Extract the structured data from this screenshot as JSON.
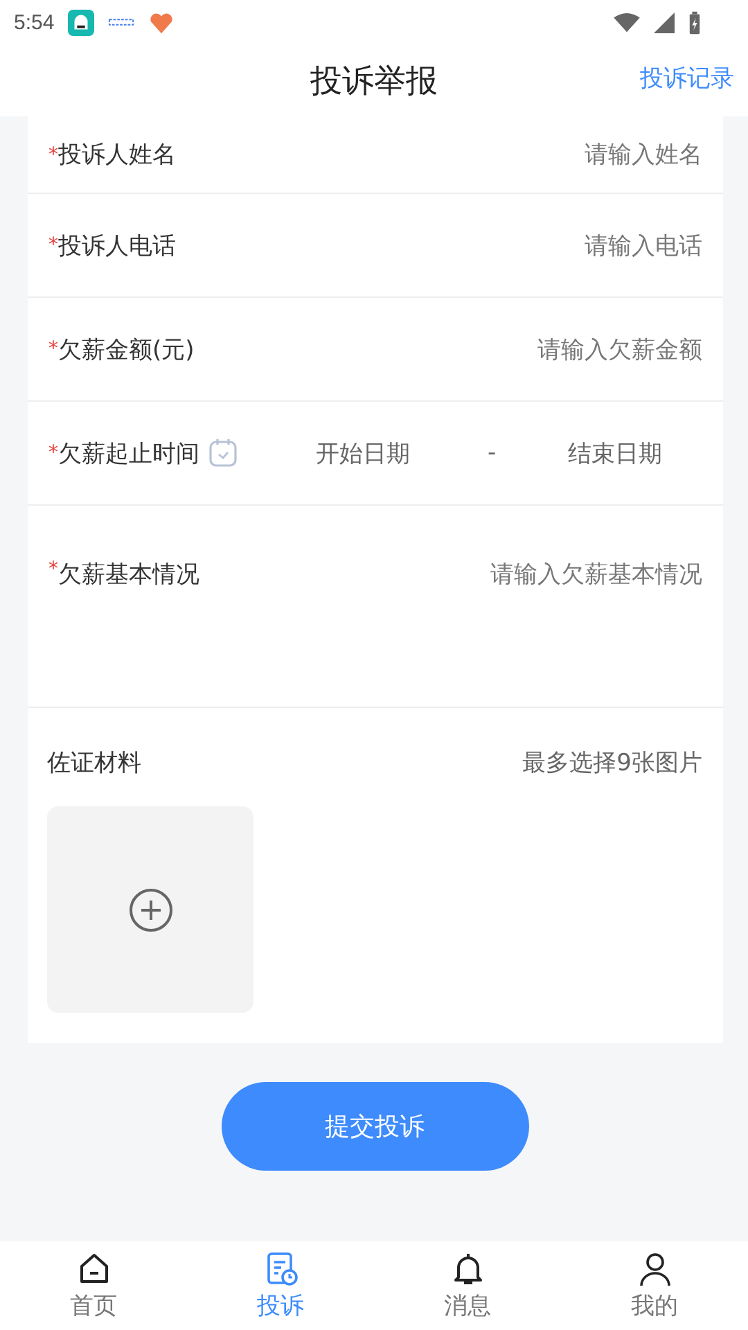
{
  "status_bar": {
    "time": "5:54"
  },
  "header": {
    "title": "投诉举报",
    "link": "投诉记录"
  },
  "fields": [
    {
      "kind": "text",
      "required_mark": "*",
      "label": "投诉人姓名",
      "placeholder": "请输入姓名"
    },
    {
      "kind": "text",
      "required_mark": "*",
      "label": "投诉人电话",
      "placeholder": "请输入电话"
    },
    {
      "kind": "text",
      "required_mark": "*",
      "label": "欠薪金额(元)",
      "placeholder": "请输入欠薪金额"
    },
    {
      "kind": "date",
      "required_mark": "*",
      "label": "欠薪起止时间",
      "start_placeholder": "开始日期",
      "separator": "-",
      "end_placeholder": "结束日期"
    },
    {
      "kind": "textarea",
      "required_mark": "*",
      "label": "欠薪基本情况",
      "placeholder": "请输入欠薪基本情况"
    }
  ],
  "upload": {
    "label": "佐证材料",
    "hint": "最多选择9张图片"
  },
  "submit": "提交投诉",
  "tabs": [
    {
      "kind": "home",
      "label": "首页",
      "selected": false
    },
    {
      "kind": "complaint",
      "label": "投诉",
      "selected": true
    },
    {
      "kind": "bell",
      "label": "消息",
      "selected": false
    },
    {
      "kind": "person",
      "label": "我的",
      "selected": false
    }
  ]
}
